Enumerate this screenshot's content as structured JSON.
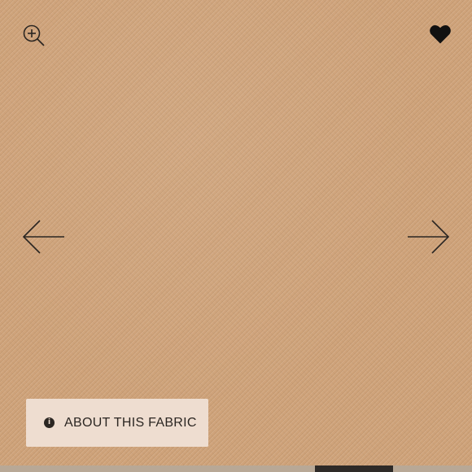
{
  "viewer": {
    "image": {
      "alt": "camel twill fabric swatch",
      "color": "#cfa37a"
    },
    "controls": {
      "zoom_icon": "zoom-in-icon",
      "favorite_icon": "heart-icon",
      "prev_icon": "arrow-left-icon",
      "next_icon": "arrow-right-icon"
    },
    "about_fabric": {
      "label": "ABOUT THIS FABRIC",
      "icon": "info-icon",
      "icon_glyph": "i",
      "background": "#eeddd0"
    },
    "colors": {
      "icon": "#2b2622",
      "thumb_active": "#2e2a27",
      "thumb_inactive": "#b8a896"
    }
  }
}
